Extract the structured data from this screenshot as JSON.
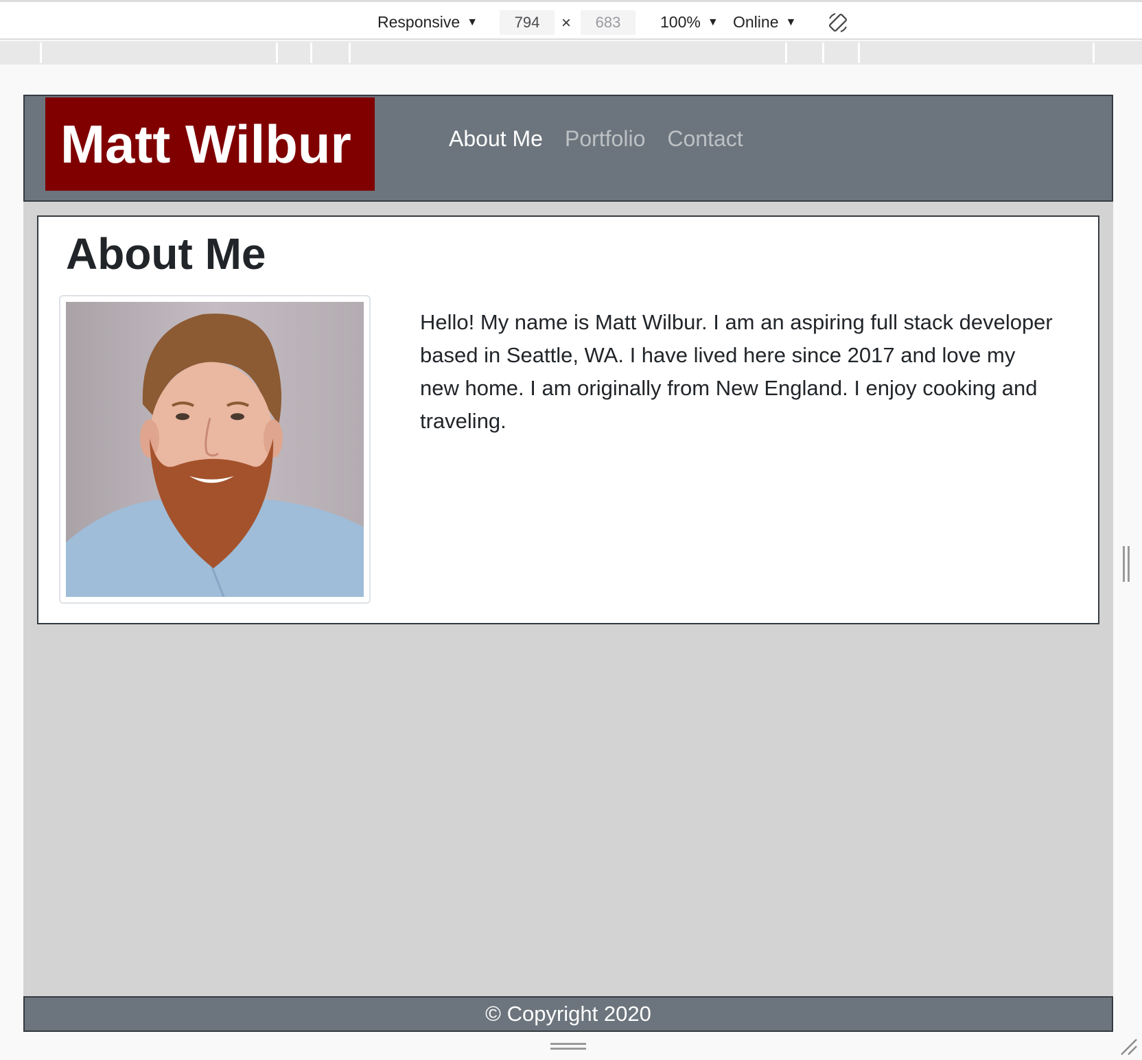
{
  "devtools": {
    "device": "Responsive",
    "width": "794",
    "height": "683",
    "times": "×",
    "zoom": "100%",
    "throttling": "Online",
    "icons": {
      "dropdown": "caret-down-icon",
      "rotate": "rotate-viewport-icon"
    }
  },
  "site": {
    "brand": "Matt Wilbur",
    "nav": [
      {
        "label": "About Me",
        "active": true
      },
      {
        "label": "Portfolio",
        "active": false
      },
      {
        "label": "Contact",
        "active": false
      }
    ],
    "about": {
      "title": "About Me",
      "bio": "Hello! My name is Matt Wilbur. I am an aspiring full stack developer based in Seattle, WA. I have lived here since 2017 and love my new home. I am originally from New England. I enjoy cooking and traveling."
    },
    "footer": "© Copyright 2020"
  },
  "colors": {
    "brand_bg": "#800000",
    "navbar_bg": "#6c757d",
    "page_bg": "#d3d3d3",
    "border": "#343a40"
  }
}
